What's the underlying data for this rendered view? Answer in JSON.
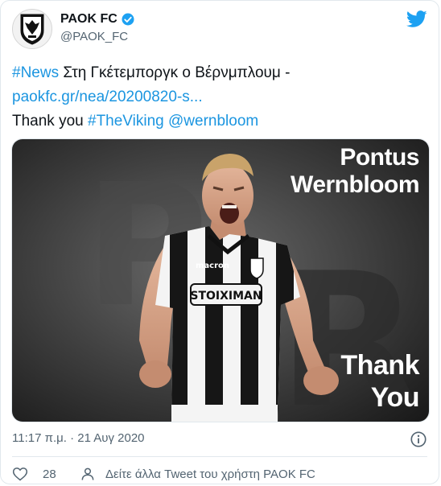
{
  "account": {
    "display_name": "PAOK FC",
    "handle": "@PAOK_FC",
    "avatar_icon": "paok-crest-icon",
    "verified_icon": "verified-badge-icon",
    "brand_icon": "twitter-bird-icon"
  },
  "tweet": {
    "hashtag_news": "#News",
    "greek_text": " Στη Γκέτεμποργκ ο Βέρνμπλουμ -",
    "url": "paokfc.gr/nea/20200820-s...",
    "thanks_text": "Thank you ",
    "hashtag_viking": "#TheViking",
    "mention": " @wernbloom"
  },
  "media": {
    "name_line1": "Pontus",
    "name_line2": "Wernbloom",
    "thanks_line1": "Thank",
    "thanks_line2": "You",
    "shirt_sponsor": "STOIXIMAN",
    "shirt_brand": "macron"
  },
  "meta": {
    "timestamp": "11:17 π.μ. · 21 Αυγ 2020"
  },
  "actions": {
    "like_count": "28",
    "see_more": "Δείτε άλλα Tweet του χρήστη PAOK FC"
  },
  "colors": {
    "link": "#1b95e0",
    "text": "#0f1419",
    "muted": "#536471"
  }
}
